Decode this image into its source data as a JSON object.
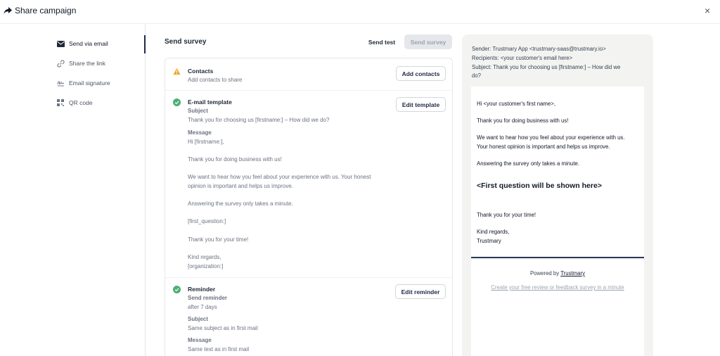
{
  "header": {
    "title": "Share campaign",
    "close_label": "×"
  },
  "sidebar": {
    "items": [
      {
        "label": "Send via email",
        "icon": "envelope-icon",
        "active": true
      },
      {
        "label": "Share the link",
        "icon": "link-icon",
        "active": false
      },
      {
        "label": "Email signature",
        "icon": "signature-icon",
        "active": false
      },
      {
        "label": "QR code",
        "icon": "qr-code-icon",
        "active": false
      }
    ]
  },
  "main": {
    "title": "Send survey",
    "send_test_label": "Send test",
    "send_survey_label": "Send survey",
    "contacts": {
      "title": "Contacts",
      "description": "Add contacts to share",
      "button": "Add contacts",
      "status": "warning"
    },
    "template": {
      "title": "E-mail template",
      "button": "Edit template",
      "status": "complete",
      "subject_label": "Subject",
      "subject": "Thank you for choosing us [firstname:] – How did we do?",
      "message_label": "Message",
      "message_lines": [
        "Hi [firstname:],",
        "Thank you for doing business with us!",
        "We want to hear how you feel about your experience with us. Your honest",
        "opinion is important and helps us improve.",
        "Answering the survey only takes a minute.",
        "[first_question:]",
        "Thank you for your time!",
        "Kind regards,",
        "[organization:]"
      ]
    },
    "reminder": {
      "title": "Reminder",
      "button": "Edit reminder",
      "status": "complete",
      "send_label": "Send reminder",
      "send_value": "after 7 days",
      "subject_label": "Subject",
      "subject": "Same subject as in first mail",
      "message_label": "Message",
      "message": "Same text as in first mail"
    }
  },
  "preview": {
    "sender": "Sender: Trustmary App <trustmary-saas@trustmary.io>",
    "recipients": "Recipients: <your customer's email here>",
    "subject_line1": "Subject: Thank you for choosing us [firstname:] – How did we",
    "subject_line2": "do?",
    "body": {
      "greeting": "Hi <your customer's first name>,",
      "thanks": "Thank you for doing business with us!",
      "para1": "We want to hear how you feel about your experience with us.",
      "para2": "Your honest opinion is important and helps us improve.",
      "minute": "Answering the survey only takes a minute.",
      "question": "<First question will be shown here>",
      "time": "Thank you for your time!",
      "regards": "Kind regards,",
      "org": "Trustmary"
    },
    "powered_by": "Powered by",
    "powered_brand": "Trustmary",
    "create_link": "Create your free review or feedback survey in a minute"
  },
  "colors": {
    "accent": "#1f2a44",
    "warning": "#f0a52b",
    "success": "#4caf73",
    "preview_bg": "#f3f4f2"
  }
}
